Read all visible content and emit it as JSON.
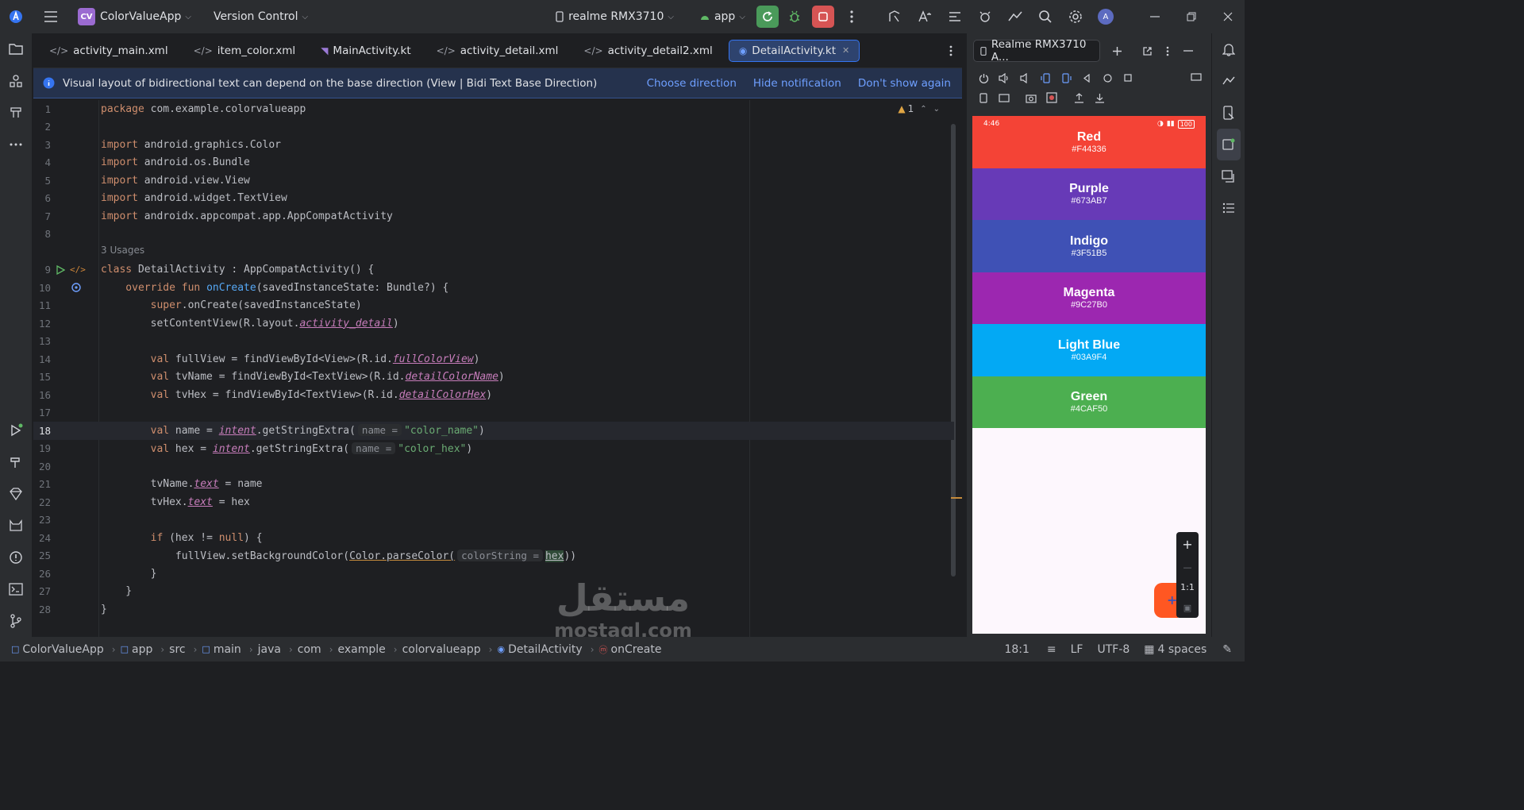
{
  "titlebar": {
    "project_badge": "CV",
    "project_name": "ColorValueApp",
    "vcs": "Version Control",
    "device": "realme RMX3710",
    "run_config": "app"
  },
  "tabs": [
    {
      "label": "activity_main.xml"
    },
    {
      "label": "item_color.xml"
    },
    {
      "label": "MainActivity.kt"
    },
    {
      "label": "activity_detail.xml"
    },
    {
      "label": "activity_detail2.xml"
    },
    {
      "label": "DetailActivity.kt"
    }
  ],
  "notification": {
    "text": "Visual layout of bidirectional text can depend on the base direction (View | Bidi Text Base Direction)",
    "choose": "Choose direction",
    "hide": "Hide notification",
    "dont_show": "Don't show again"
  },
  "editor": {
    "warning_count": "1",
    "usages": "3 Usages",
    "hints": {
      "name": "name =",
      "colorString": "colorString ="
    },
    "line_numbers": [
      "1",
      "2",
      "3",
      "4",
      "5",
      "6",
      "7",
      "8",
      "9",
      "10",
      "11",
      "12",
      "13",
      "14",
      "15",
      "16",
      "17",
      "18",
      "19",
      "20",
      "21",
      "22",
      "23",
      "24",
      "25",
      "26",
      "27",
      "28"
    ],
    "code": {
      "l1_kw": "package",
      "l1": " com.example.colorvalueapp",
      "l3_kw": "import",
      "l3": " android.graphics.Color",
      "l4_kw": "import",
      "l4": " android.os.Bundle",
      "l5_kw": "import",
      "l5": " android.view.View",
      "l6_kw": "import",
      "l6": " android.widget.TextView",
      "l7_kw": "import",
      "l7": " androidx.appcompat.app.AppCompatActivity",
      "l9_kw": "class",
      "l9": " DetailActivity : AppCompatActivity() {",
      "l10_kw": "    override fun",
      "l10_fn": "onCreate",
      "l10": "(savedInstanceState: Bundle?) {",
      "l11_kw": "        super",
      "l11": ".onCreate(savedInstanceState)",
      "l12": "        setContentView(R.layout.",
      "l12_p": "activity_detail",
      "l12_e": ")",
      "l14_kw": "        val",
      "l14": " fullView = findViewById<View>(R.id.",
      "l14_p": "fullColorView",
      "l14_e": ")",
      "l15_kw": "        val",
      "l15": " tvName = findViewById<TextView>(R.id.",
      "l15_p": "detailColorName",
      "l15_e": ")",
      "l16_kw": "        val",
      "l16": " tvHex = findViewById<TextView>(R.id.",
      "l16_p": "detailColorHex",
      "l16_e": ")",
      "l18_kw": "        val",
      "l18": " name = ",
      "l18_p": "intent",
      "l18_m": ".getStringExtra(",
      "l18_s": "\"color_name\"",
      "l18_e": ")",
      "l19_kw": "        val",
      "l19": " hex = ",
      "l19_p": "intent",
      "l19_m": ".getStringExtra(",
      "l19_s": "\"color_hex\"",
      "l19_e": ")",
      "l21": "        tvName.",
      "l21_p": "text",
      "l21_e": " = name",
      "l22": "        tvHex.",
      "l22_p": "text",
      "l22_e": " = hex",
      "l24_kw": "        if",
      "l24": " (hex != ",
      "l24_k2": "null",
      "l24_e": ") {",
      "l25": "            fullView.setBackgroundColor(",
      "l25_u": "Color.parseColor(",
      "l25_v": "hex",
      "l25_e": "))",
      "l26": "        }",
      "l27": "    }",
      "l28": "}"
    }
  },
  "device_panel": {
    "tab_label": "Realme RMX3710 A...",
    "status_time": "4:46",
    "battery": "100",
    "zoom_label": "1:1",
    "colors": [
      {
        "name": "Red",
        "hex": "#F44336"
      },
      {
        "name": "Purple",
        "hex": "#673AB7"
      },
      {
        "name": "Indigo",
        "hex": "#3F51B5"
      },
      {
        "name": "Magenta",
        "hex": "#9C27B0"
      },
      {
        "name": "Light Blue",
        "hex": "#03A9F4"
      },
      {
        "name": "Green",
        "hex": "#4CAF50"
      }
    ]
  },
  "footer": {
    "breadcrumbs": [
      "ColorValueApp",
      "app",
      "src",
      "main",
      "java",
      "com",
      "example",
      "colorvalueapp",
      "DetailActivity",
      "onCreate"
    ],
    "position": "18:1",
    "line_sep": "LF",
    "encoding": "UTF-8",
    "indent": "4 spaces"
  },
  "watermark": {
    "arabic": "مستقل",
    "latin": "mostaql.com"
  }
}
